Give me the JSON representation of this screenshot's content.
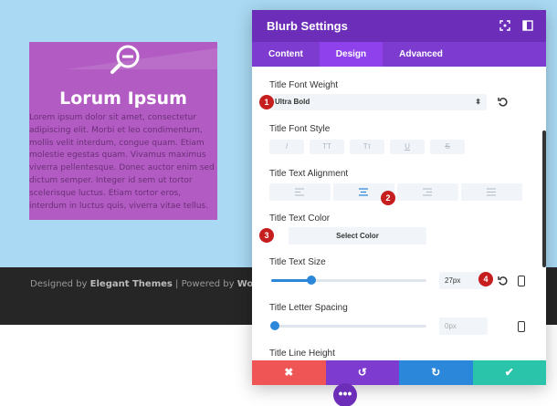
{
  "blurb": {
    "title": "Lorum Ipsum",
    "icon": "zoom-out-icon",
    "body": "Lorem ipsum dolor sit amet, consectetur adipiscing elit. Morbi et leo condimentum, mollis velit interdum, congue quam. Etiam molestie egestas quam. Vivamus maximus viverra pellentesque. Donec auctor enim sed dictum semper. Integer id sem ut tortor scelerisque luctus. Etiam tortor eros, interdum in luctus quis, viverra vitae tellus."
  },
  "footer": {
    "prefix": "Designed by ",
    "brand1": "Elegant Themes",
    "mid": " | Powered by ",
    "brand2": "WordPress"
  },
  "modal": {
    "title": "Blurb Settings",
    "tabs": [
      {
        "label": "Content"
      },
      {
        "label": "Design",
        "active": true
      },
      {
        "label": "Advanced"
      }
    ],
    "fields": {
      "font_weight": {
        "label": "Title Font Weight",
        "value": "Ultra Bold"
      },
      "font_style": {
        "label": "Title Font Style",
        "buttons": [
          "I",
          "TT",
          "Tт",
          "U",
          "S"
        ]
      },
      "text_alignment": {
        "label": "Title Text Alignment",
        "selected": "center"
      },
      "text_color": {
        "label": "Title Text Color",
        "button": "Select Color"
      },
      "text_size": {
        "label": "Title Text Size",
        "value": "27px",
        "fraction": 0.26
      },
      "letter_spacing": {
        "label": "Title Letter Spacing",
        "placeholder": "0px",
        "fraction": 0.0
      },
      "line_height": {
        "label": "Title Line Height"
      }
    },
    "footer_buttons": [
      {
        "name": "cancel",
        "glyph": "✖",
        "color": "#ef5555"
      },
      {
        "name": "undo",
        "glyph": "↺",
        "color": "#7e3bd0"
      },
      {
        "name": "redo",
        "glyph": "↻",
        "color": "#2b87da"
      },
      {
        "name": "save",
        "glyph": "✔",
        "color": "#29c4a9"
      }
    ]
  },
  "badges": [
    "1",
    "2",
    "3",
    "4"
  ],
  "more_glyph": "•••",
  "colors": {
    "accent": "#6c2eb9",
    "tab_bar": "#7e3bd0",
    "badge": "#c61e1e",
    "slider": "#2b87da"
  }
}
